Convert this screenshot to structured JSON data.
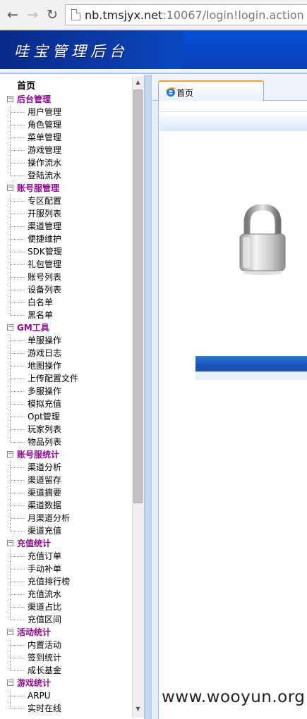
{
  "browser": {
    "back_icon": "back-arrow-icon",
    "forward_icon": "forward-arrow-icon",
    "reload_icon": "reload-icon",
    "url_host": "nb.tmsjyx.net",
    "url_rest": ":10067/login!login.action"
  },
  "header": {
    "title": "哇宝管理后台"
  },
  "sidebar": {
    "home": "首页",
    "groups": [
      {
        "label": "后台管理",
        "items": [
          "用户管理",
          "角色管理",
          "菜单管理",
          "游戏管理",
          "操作流水",
          "登陆流水"
        ]
      },
      {
        "label": "账号服管理",
        "items": [
          "专区配置",
          "开服列表",
          "渠道管理",
          "便捷维护",
          "SDK管理",
          "礼包管理",
          "账号列表",
          "设备列表",
          "白名单",
          "黑名单"
        ]
      },
      {
        "label": "GM工具",
        "items": [
          "单服操作",
          "游戏日志",
          "地图操作",
          "上传配置文件",
          "多服操作",
          "模拟充值",
          "Opt管理",
          "玩家列表",
          "物品列表"
        ]
      },
      {
        "label": "账号服统计",
        "items": [
          "渠道分析",
          "渠道留存",
          "渠道摘要",
          "渠道数据",
          "月渠道分析",
          "渠道充值"
        ]
      },
      {
        "label": "充值统计",
        "items": [
          "充值订单",
          "手动补单",
          "充值排行榜",
          "充值流水",
          "渠道占比",
          "充值区间"
        ]
      },
      {
        "label": "活动统计",
        "items": [
          "内置活动",
          "签到统计",
          "成长基金"
        ]
      },
      {
        "label": "游戏统计",
        "items": [
          "ARPU",
          "实时在线"
        ]
      }
    ]
  },
  "tabs": [
    {
      "label": "首页",
      "icon": "ie-browser-icon"
    }
  ],
  "content": {
    "lock_icon": "padlock-icon"
  },
  "watermark": "www.wooyun.org",
  "colors": {
    "banner": "#0b3fb0",
    "group_label": "#8a0c8c",
    "tab_accent": "#f0a030",
    "login_bar": "#1a56b8"
  }
}
